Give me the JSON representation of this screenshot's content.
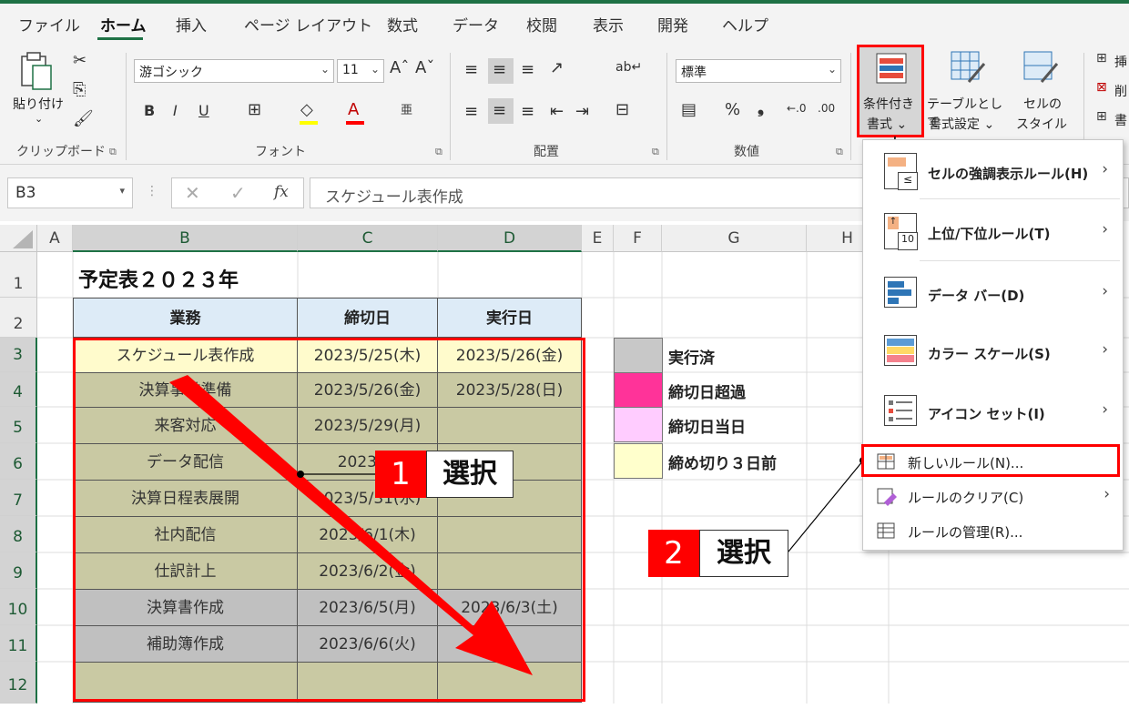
{
  "ribbon": {
    "tabs": [
      "ファイル",
      "ホーム",
      "挿入",
      "ページ レイアウト",
      "数式",
      "データ",
      "校閲",
      "表示",
      "開発",
      "ヘルプ"
    ],
    "active_tab": "ホーム",
    "groups": {
      "clipboard": "クリップボード",
      "font": "フォント",
      "alignment": "配置",
      "number": "数値"
    },
    "paste_label": "貼り付け",
    "font_name": "游ゴシック",
    "font_size": "11",
    "number_format": "標準",
    "bold": "B",
    "italic": "I",
    "underline": "U",
    "cond_format": [
      "条件付き",
      "書式 ⌄"
    ],
    "table_format": [
      "テーブルとして",
      "書式設定 ⌄"
    ],
    "cell_style": [
      "セルの",
      "スタイル ⌄"
    ],
    "right_partial": [
      "挿",
      "削",
      "書"
    ]
  },
  "formula_bar": {
    "name_box": "B3",
    "fx": "fx",
    "content": "スケジュール表作成"
  },
  "columns": [
    "A",
    "B",
    "C",
    "D",
    "E",
    "F",
    "G",
    "H"
  ],
  "rows": [
    "1",
    "2",
    "3",
    "4",
    "5",
    "6",
    "7",
    "8",
    "9",
    "10",
    "11",
    "12"
  ],
  "sheet": {
    "title": "予定表２０２３年",
    "headers": [
      "業務",
      "締切日",
      "実行日"
    ],
    "data": [
      {
        "task": "スケジュール表作成",
        "deadline": "2023/5/25(木)",
        "done": "2023/5/26(金)",
        "fill": "#fffbcc"
      },
      {
        "task": "決算事前準備",
        "deadline": "2023/5/26(金)",
        "done": "2023/5/28(日)",
        "fill": "#c9c9a3"
      },
      {
        "task": "来客対応",
        "deadline": "2023/5/29(月)",
        "done": "",
        "fill": "#c9c9a3"
      },
      {
        "task": "データ配信",
        "deadline": "2023/5/",
        "done": "",
        "fill": "#c9c9a3"
      },
      {
        "task": "決算日程表展開",
        "deadline": "2023/5/31(水)",
        "done": "",
        "fill": "#c9c9a3"
      },
      {
        "task": "社内配信",
        "deadline": "2023/6/1(木)",
        "done": "",
        "fill": "#c9c9a3"
      },
      {
        "task": "仕訳計上",
        "deadline": "2023/6/2(金)",
        "done": "",
        "fill": "#c9c9a3"
      },
      {
        "task": "決算書作成",
        "deadline": "2023/6/5(月)",
        "done": "2023/6/3(土)",
        "fill": "#c0c0c0"
      },
      {
        "task": "補助簿作成",
        "deadline": "2023/6/6(火)",
        "done": "",
        "fill": "#c0c0c0"
      },
      {
        "task": "",
        "deadline": "",
        "done": "",
        "fill": "#c9c9a3"
      }
    ],
    "legend": [
      {
        "label": "実行済",
        "color": "#c8c8c8"
      },
      {
        "label": "締切日超過",
        "color": "#ff3399"
      },
      {
        "label": "締切日当日",
        "color": "#ffccff"
      },
      {
        "label": "締め切り３日前",
        "color": "#ffffcc"
      }
    ]
  },
  "menu": {
    "items_main": [
      {
        "label": "セルの強調表示ルール(H)"
      },
      {
        "label": "上位/下位ルール(T)"
      },
      {
        "label": "データ バー(D)"
      },
      {
        "label": "カラー スケール(S)"
      },
      {
        "label": "アイコン セット(I)"
      }
    ],
    "items_sub": [
      {
        "label": "新しいルール(N)..."
      },
      {
        "label": "ルールのクリア(C)"
      },
      {
        "label": "ルールの管理(R)..."
      }
    ],
    "icon_glyphs": {
      "top10": "10",
      "lte": "≤"
    }
  },
  "callouts": [
    {
      "num": "1",
      "text": "選択"
    },
    {
      "num": "2",
      "text": "選択"
    }
  ],
  "colors": {
    "accent_green": "#1e7145",
    "highlight_red": "#ff0000",
    "header_blue": "#ddebf7"
  }
}
